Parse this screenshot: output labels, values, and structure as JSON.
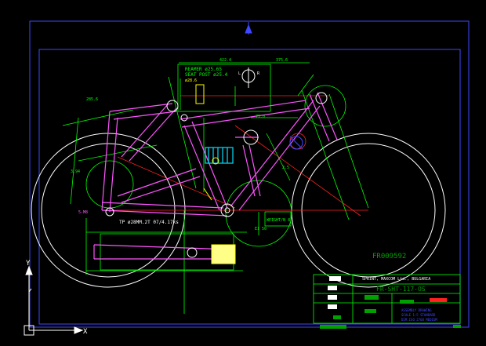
{
  "drawing": {
    "notes": {
      "reamer": "REAMER ø25.65",
      "seat_post": "SEAT POST ø25.4",
      "seat_note": "ø28.6",
      "lug_left": "L",
      "lug_right": "R",
      "weight": "WEIGHT/N 8"
    },
    "dims": {
      "top_a": "422.4",
      "top_b": "375.6",
      "mid_a": "75.0",
      "mid_b": "2.5",
      "left_a": "285.6",
      "left_b": "3.94",
      "bottom_tube": "TP ø28MM.2T 07/4.17ks",
      "rear_left": "5-M8",
      "wheel_note": "EI 50"
    },
    "title_block": {
      "drawing_no": "FR009592",
      "company": "SPRINT, MAXCOM Ltd., BULGARIA",
      "sheet": "FR-SHT-117-OS",
      "lines": [
        "ASSEMBLY DRAWING",
        "SCALE 1:5 STANDARD",
        "DIM.ISO 2768 MEDIUM"
      ]
    },
    "colors": {
      "background": "#000000",
      "border": "#3f48ff",
      "frame": "#00ff00",
      "tube": "#ff55ff",
      "dimension": "#00ff00",
      "wheel": "#ffffff",
      "centerline": "#ff2020",
      "shock": "#00e0ff",
      "yellow": "#ffff00"
    },
    "icons": {
      "ucs": "ucs-axis-icon",
      "north": "north-arrow-icon"
    },
    "ucs_labels": {
      "x": "X",
      "y": "Y"
    }
  }
}
